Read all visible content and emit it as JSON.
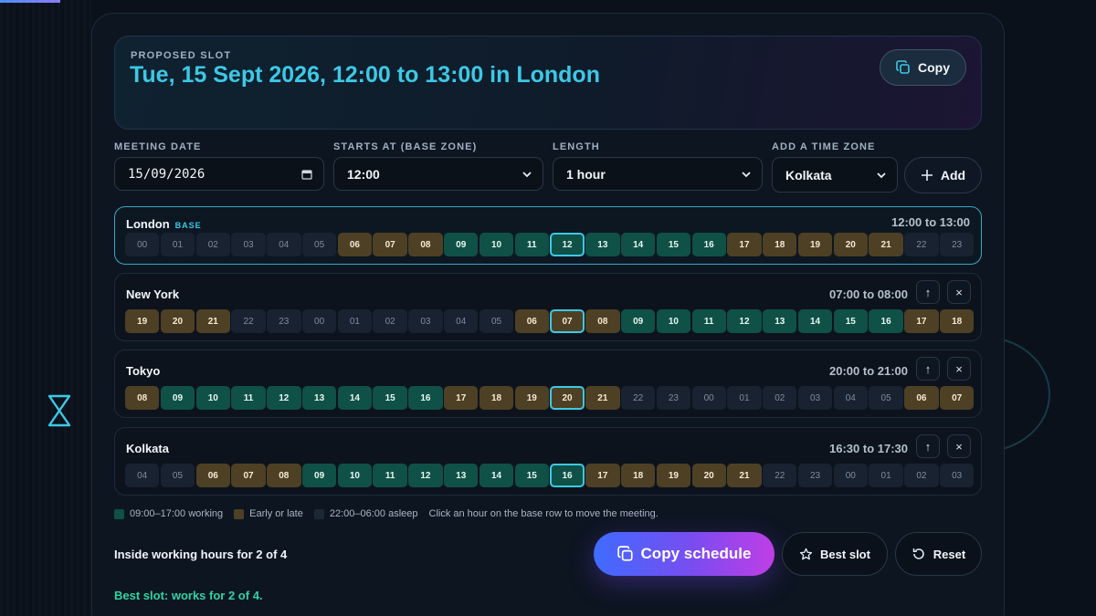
{
  "hero": {
    "kicker": "PROPOSED SLOT",
    "title": "Tue, 15 Sept 2026, 12:00 to 13:00 in London",
    "copy_label": "Copy"
  },
  "form": {
    "date_label": "MEETING DATE",
    "date_value": "15/09/2026",
    "start_label": "STARTS AT (BASE ZONE)",
    "start_value": "12:00",
    "length_label": "LENGTH",
    "length_value": "1 hour",
    "zone_label": "ADD A TIME ZONE",
    "zone_value": "Kolkata",
    "add_label": "Add"
  },
  "rows": [
    {
      "name": "London",
      "badge": "BASE",
      "range": "12:00 to 13:00",
      "base": true,
      "hours": [
        "00",
        "01",
        "02",
        "03",
        "04",
        "05",
        "06",
        "07",
        "08",
        "09",
        "10",
        "11",
        "12",
        "13",
        "14",
        "15",
        "16",
        "17",
        "18",
        "19",
        "20",
        "21",
        "22",
        "23"
      ],
      "types": [
        "s",
        "s",
        "s",
        "s",
        "s",
        "s",
        "e",
        "e",
        "e",
        "w",
        "w",
        "w",
        "w",
        "w",
        "w",
        "w",
        "w",
        "e",
        "e",
        "e",
        "e",
        "e",
        "s",
        "s"
      ],
      "selected": 12
    },
    {
      "name": "New York",
      "badge": "",
      "range": "07:00 to 08:00",
      "base": false,
      "hours": [
        "19",
        "20",
        "21",
        "22",
        "23",
        "00",
        "01",
        "02",
        "03",
        "04",
        "05",
        "06",
        "07",
        "08",
        "09",
        "10",
        "11",
        "12",
        "13",
        "14",
        "15",
        "16",
        "17",
        "18"
      ],
      "types": [
        "e",
        "e",
        "e",
        "s",
        "s",
        "s",
        "s",
        "s",
        "s",
        "s",
        "s",
        "e",
        "e",
        "e",
        "w",
        "w",
        "w",
        "w",
        "w",
        "w",
        "w",
        "w",
        "e",
        "e"
      ],
      "selected": 12
    },
    {
      "name": "Tokyo",
      "badge": "",
      "range": "20:00 to 21:00",
      "base": false,
      "hours": [
        "08",
        "09",
        "10",
        "11",
        "12",
        "13",
        "14",
        "15",
        "16",
        "17",
        "18",
        "19",
        "20",
        "21",
        "22",
        "23",
        "00",
        "01",
        "02",
        "03",
        "04",
        "05",
        "06",
        "07"
      ],
      "types": [
        "e",
        "w",
        "w",
        "w",
        "w",
        "w",
        "w",
        "w",
        "w",
        "e",
        "e",
        "e",
        "e",
        "e",
        "s",
        "s",
        "s",
        "s",
        "s",
        "s",
        "s",
        "s",
        "e",
        "e"
      ],
      "selected": 12
    },
    {
      "name": "Kolkata",
      "badge": "",
      "range": "16:30 to 17:30",
      "base": false,
      "hours": [
        "04",
        "05",
        "06",
        "07",
        "08",
        "09",
        "10",
        "11",
        "12",
        "13",
        "14",
        "15",
        "16",
        "17",
        "18",
        "19",
        "20",
        "21",
        "22",
        "23",
        "00",
        "01",
        "02",
        "03"
      ],
      "types": [
        "s",
        "s",
        "e",
        "e",
        "e",
        "w",
        "w",
        "w",
        "w",
        "w",
        "w",
        "w",
        "w",
        "e",
        "e",
        "e",
        "e",
        "e",
        "s",
        "s",
        "s",
        "s",
        "s",
        "s"
      ],
      "selected": 12
    }
  ],
  "row_controls": {
    "up": "↑",
    "remove": "×"
  },
  "legend": {
    "working": "09:00–17:00 working",
    "edge": "Early or late",
    "asleep": "22:00–06:00 asleep",
    "hint": "Click an hour on the base row to move the meeting."
  },
  "colors": {
    "working": "#0f5147",
    "edge": "#4e4024",
    "asleep": "#182230",
    "accent": "#3cc9e6"
  },
  "summary": "Inside working hours for 2 of 4",
  "actions": {
    "copy_schedule": "Copy schedule",
    "best_slot": "Best slot",
    "reset": "Reset"
  },
  "best_note": "Best slot: works for 2 of 4."
}
